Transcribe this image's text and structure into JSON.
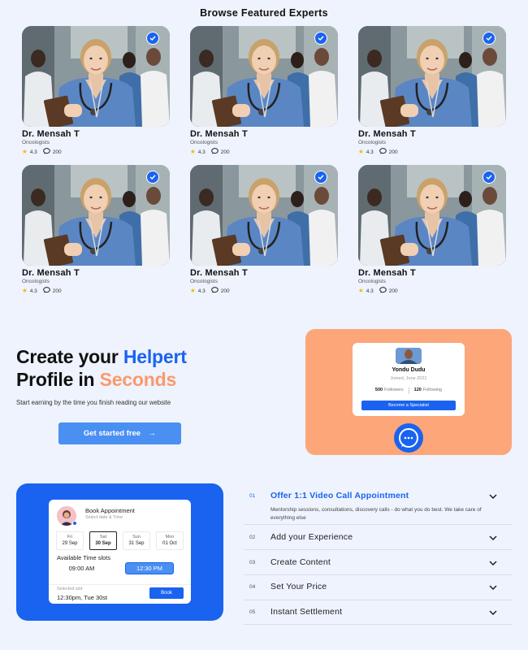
{
  "featured": {
    "title": "Browse Featured Experts",
    "experts": [
      {
        "name": "Dr. Mensah T",
        "specialty": "Oncologists",
        "rating": "4.3",
        "reviews": "200"
      },
      {
        "name": "Dr. Mensah T",
        "specialty": "Oncologists",
        "rating": "4.3",
        "reviews": "200"
      },
      {
        "name": "Dr. Mensah T",
        "specialty": "Oncologists",
        "rating": "4.3",
        "reviews": "200"
      },
      {
        "name": "Dr. Mensah T",
        "specialty": "Oncologists",
        "rating": "4.3",
        "reviews": "200"
      },
      {
        "name": "Dr. Mensah T",
        "specialty": "Oncologists",
        "rating": "4.3",
        "reviews": "200"
      },
      {
        "name": "Dr. Mensah T",
        "specialty": "Oncologists",
        "rating": "4.3",
        "reviews": "200"
      }
    ]
  },
  "hero": {
    "line1_a": "Create your ",
    "line1_b": "Helpert",
    "line2_a": "Profile in ",
    "line2_b": "Seconds",
    "subtitle": "Start earning by the time you finish reading our website",
    "cta_label": "Get started free",
    "cta_arrow": "→"
  },
  "profile_card": {
    "name": "Yondu Dudu",
    "joined": "Joined, June 2021",
    "followers_count": "500",
    "followers_label": "Followers",
    "following_count": "120",
    "following_label": "Following",
    "button_label": "Become a Specialist"
  },
  "booking": {
    "title": "Book Appointment",
    "subtitle": "Select date & Time",
    "dates": [
      {
        "day": "Fri",
        "date": "29 Sep"
      },
      {
        "day": "Sat",
        "date": "30 Sep"
      },
      {
        "day": "Sun",
        "date": "31 Sep"
      },
      {
        "day": "Mon",
        "date": "01 Oct"
      }
    ],
    "slots_label": "Available Time slots",
    "slots": [
      "09:00 AM",
      "12:30 PM"
    ],
    "selected_label": "Selected slot",
    "selected_value": "12:30pm, Tue 30st",
    "book_label": "Book"
  },
  "steps": [
    {
      "num": "01",
      "label": "Offer 1:1 Video Call Appointment",
      "desc": "Mentorship sessions, consultations, discovery calls - do what you do best. We take care of everything else"
    },
    {
      "num": "02",
      "label": "Add your Experience"
    },
    {
      "num": "03",
      "label": "Create Content"
    },
    {
      "num": "04",
      "label": "Set Your Price"
    },
    {
      "num": "05",
      "label": "Instant Settlement"
    }
  ],
  "colors": {
    "accent_blue": "#1a63f0",
    "accent_orange": "#fa9a6c",
    "background": "#eef3fd"
  }
}
